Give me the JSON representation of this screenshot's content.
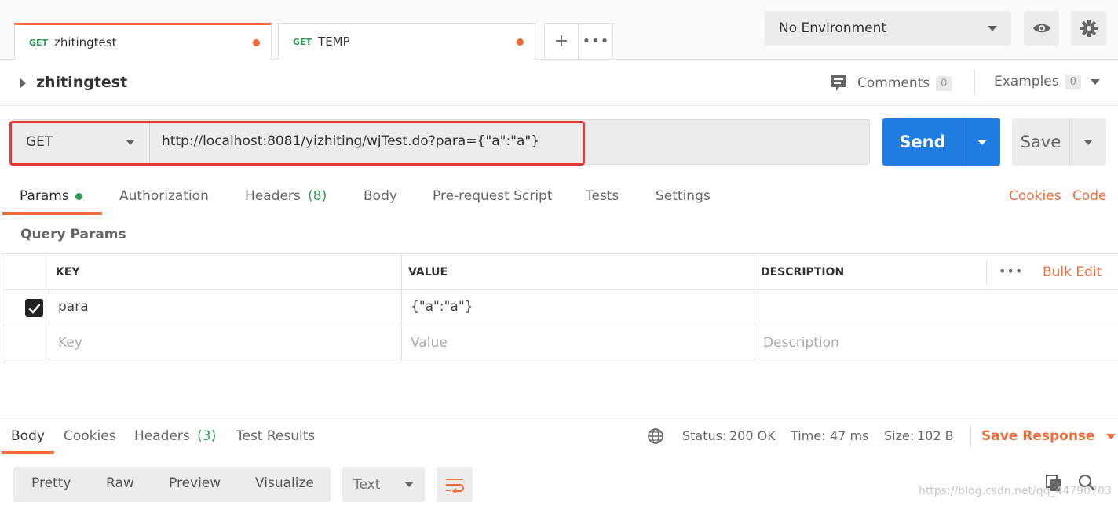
{
  "tabs": [
    {
      "method": "GET",
      "name": "zhitingtest"
    },
    {
      "method": "GET",
      "name": "TEMP"
    }
  ],
  "environment": {
    "selected": "No Environment"
  },
  "request": {
    "title": "zhitingtest",
    "comments_label": "Comments",
    "comments_count": "0",
    "examples_label": "Examples",
    "examples_count": "0",
    "method": "GET",
    "url": "http://localhost:8081/yizhiting/wjTest.do?para={\"a\":\"a\"}",
    "send_label": "Send",
    "save_label": "Save"
  },
  "subtabs": {
    "params": "Params",
    "authorization": "Authorization",
    "headers": "Headers",
    "headers_count": "(8)",
    "body": "Body",
    "prerequest": "Pre-request Script",
    "tests": "Tests",
    "settings": "Settings",
    "cookies": "Cookies",
    "code": "Code"
  },
  "params": {
    "section_title": "Query Params",
    "columns": [
      "KEY",
      "VALUE",
      "DESCRIPTION"
    ],
    "bulk_edit": "Bulk Edit",
    "rows": [
      {
        "key": "para",
        "value": "{\"a\":\"a\"}",
        "description": ""
      }
    ],
    "placeholders": {
      "key": "Key",
      "value": "Value",
      "description": "Description"
    }
  },
  "response": {
    "tabs": {
      "body": "Body",
      "cookies": "Cookies",
      "headers": "Headers",
      "headers_count": "(3)",
      "test_results": "Test Results"
    },
    "status_label": "Status:",
    "status_value": "200 OK",
    "time_label": "Time:",
    "time_value": "47 ms",
    "size_label": "Size:",
    "size_value": "102 B",
    "save_response": "Save Response",
    "views": [
      "Pretty",
      "Raw",
      "Preview",
      "Visualize"
    ],
    "format": "Text"
  },
  "watermark": "https://blog.csdn.net/qq_44790703",
  "colors": {
    "accent": "#f26b3a",
    "send": "#1f7ce0",
    "success": "#2a9d52",
    "highlight": "#e53935"
  }
}
